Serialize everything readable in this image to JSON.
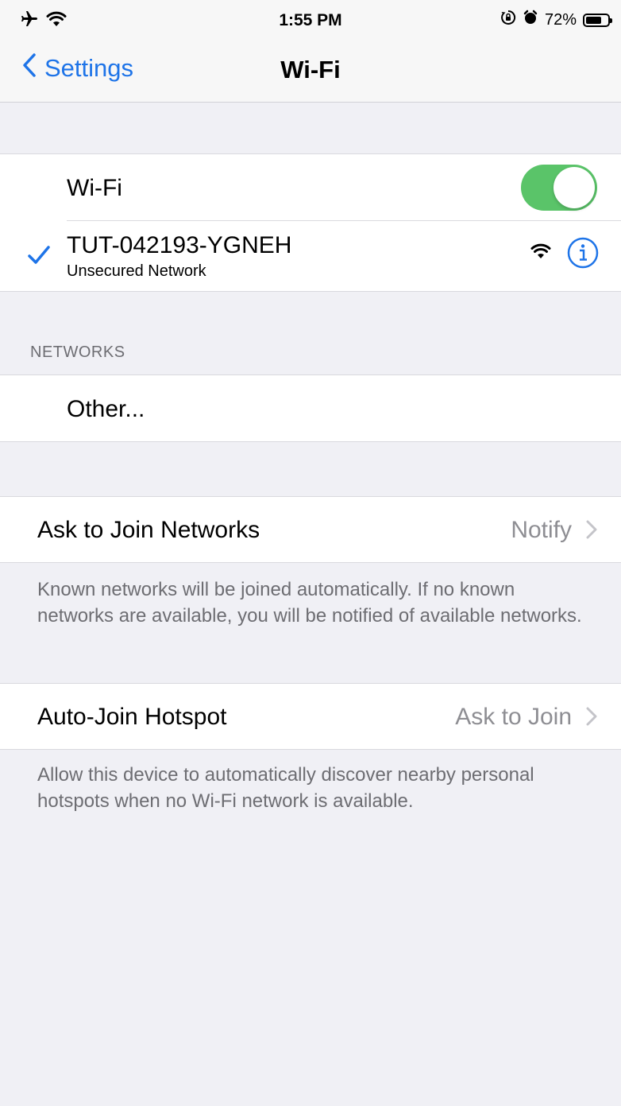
{
  "status_bar": {
    "time": "1:55 PM",
    "battery_text": "72%",
    "battery_level": 0.72,
    "icons": [
      "airplane-mode-icon",
      "wifi-signal-icon",
      "orientation-lock-icon",
      "alarm-icon",
      "battery-icon"
    ]
  },
  "nav": {
    "back_label": "Settings",
    "title": "Wi-Fi"
  },
  "wifi": {
    "toggle_label": "Wi-Fi",
    "enabled": true,
    "connected_network": {
      "name": "TUT-042193-YGNEH",
      "subtitle": "Unsecured Network"
    }
  },
  "networks": {
    "header": "NETWORKS",
    "other_label": "Other..."
  },
  "ask_to_join": {
    "label": "Ask to Join Networks",
    "value": "Notify",
    "footer": "Known networks will be joined automatically. If no known networks are available, you will be notified of available networks."
  },
  "auto_join": {
    "label": "Auto-Join Hotspot",
    "value": "Ask to Join",
    "footer": "Allow this device to automatically discover nearby personal hotspots when no Wi-Fi network is available."
  },
  "colors": {
    "accent": "#1e74e8",
    "toggle_on": "#5ac469",
    "background": "#f0f0f5",
    "secondary_text": "#6d6d72"
  }
}
